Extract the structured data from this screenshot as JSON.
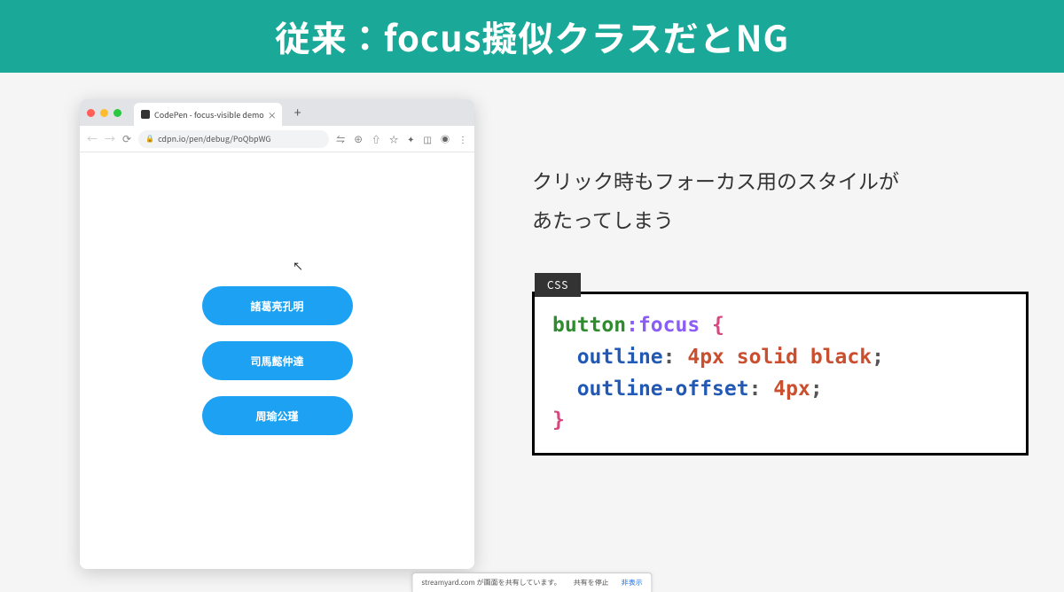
{
  "title": "従来：focus擬似クラスだとNG",
  "browser": {
    "tab_title": "CodePen - focus-visible demo",
    "url": "cdpn.io/pen/debug/PoQbpWG",
    "buttons": [
      "諸葛亮孔明",
      "司馬懿仲達",
      "周瑜公瑾"
    ]
  },
  "explanation": {
    "line1": "クリック時もフォーカス用のスタイルが",
    "line2": "あたってしまう"
  },
  "code": {
    "label": "CSS",
    "selector": "button",
    "pseudo": ":focus",
    "brace_open": " {",
    "prop1": "outline",
    "val1": "4px solid black",
    "prop2": "outline-offset",
    "val2": "4px",
    "brace_close": "}"
  },
  "share_bar": {
    "text": "streamyard.com が画面を共有しています。",
    "stop": "共有を停止",
    "hide": "非表示"
  }
}
